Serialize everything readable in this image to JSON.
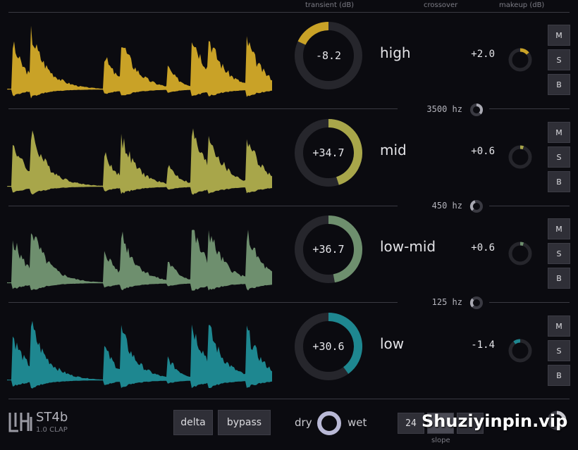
{
  "header": {
    "transient_label": "transient (dB)",
    "crossover_label": "crossover",
    "makeup_label": "makeup (dB)"
  },
  "bands": [
    {
      "name": "high",
      "transient": "-8.2",
      "transient_norm": 0.18,
      "transient_dir": -1,
      "makeup": "+2.0",
      "makeup_norm": 0.14,
      "makeup_dir": 1,
      "color": "#c9a227",
      "mute": "M",
      "solo": "S",
      "bypass": "B"
    },
    {
      "name": "mid",
      "transient": "+34.7",
      "transient_norm": 0.45,
      "transient_dir": 1,
      "makeup": "+0.6",
      "makeup_norm": 0.05,
      "makeup_dir": 1,
      "color": "#a8a64a",
      "mute": "M",
      "solo": "S",
      "bypass": "B"
    },
    {
      "name": "low-mid",
      "transient": "+36.7",
      "transient_norm": 0.47,
      "transient_dir": 1,
      "makeup": "+0.6",
      "makeup_norm": 0.05,
      "makeup_dir": 1,
      "color": "#6e8f6e",
      "mute": "M",
      "solo": "S",
      "bypass": "B"
    },
    {
      "name": "low",
      "transient": "+30.6",
      "transient_norm": 0.4,
      "transient_dir": 1,
      "makeup": "-1.4",
      "makeup_norm": 0.1,
      "makeup_dir": -1,
      "color": "#1e8790",
      "mute": "M",
      "solo": "S",
      "bypass": "B"
    }
  ],
  "crossovers": [
    {
      "label": "3500 hz"
    },
    {
      "label": "450 hz"
    },
    {
      "label": "125 hz"
    }
  ],
  "footer": {
    "brand_logo": "LHi",
    "product_name": "ST4b",
    "version": "1.0 CLAP",
    "delta_label": "delta",
    "bypass_label": "bypass",
    "dry_label": "dry",
    "wet_label": "wet",
    "drywet_norm": 1.0,
    "slope_options": [
      "24",
      "",
      ""
    ],
    "slope_label": "slope",
    "watermark": "Shuziyinpin.vip"
  }
}
